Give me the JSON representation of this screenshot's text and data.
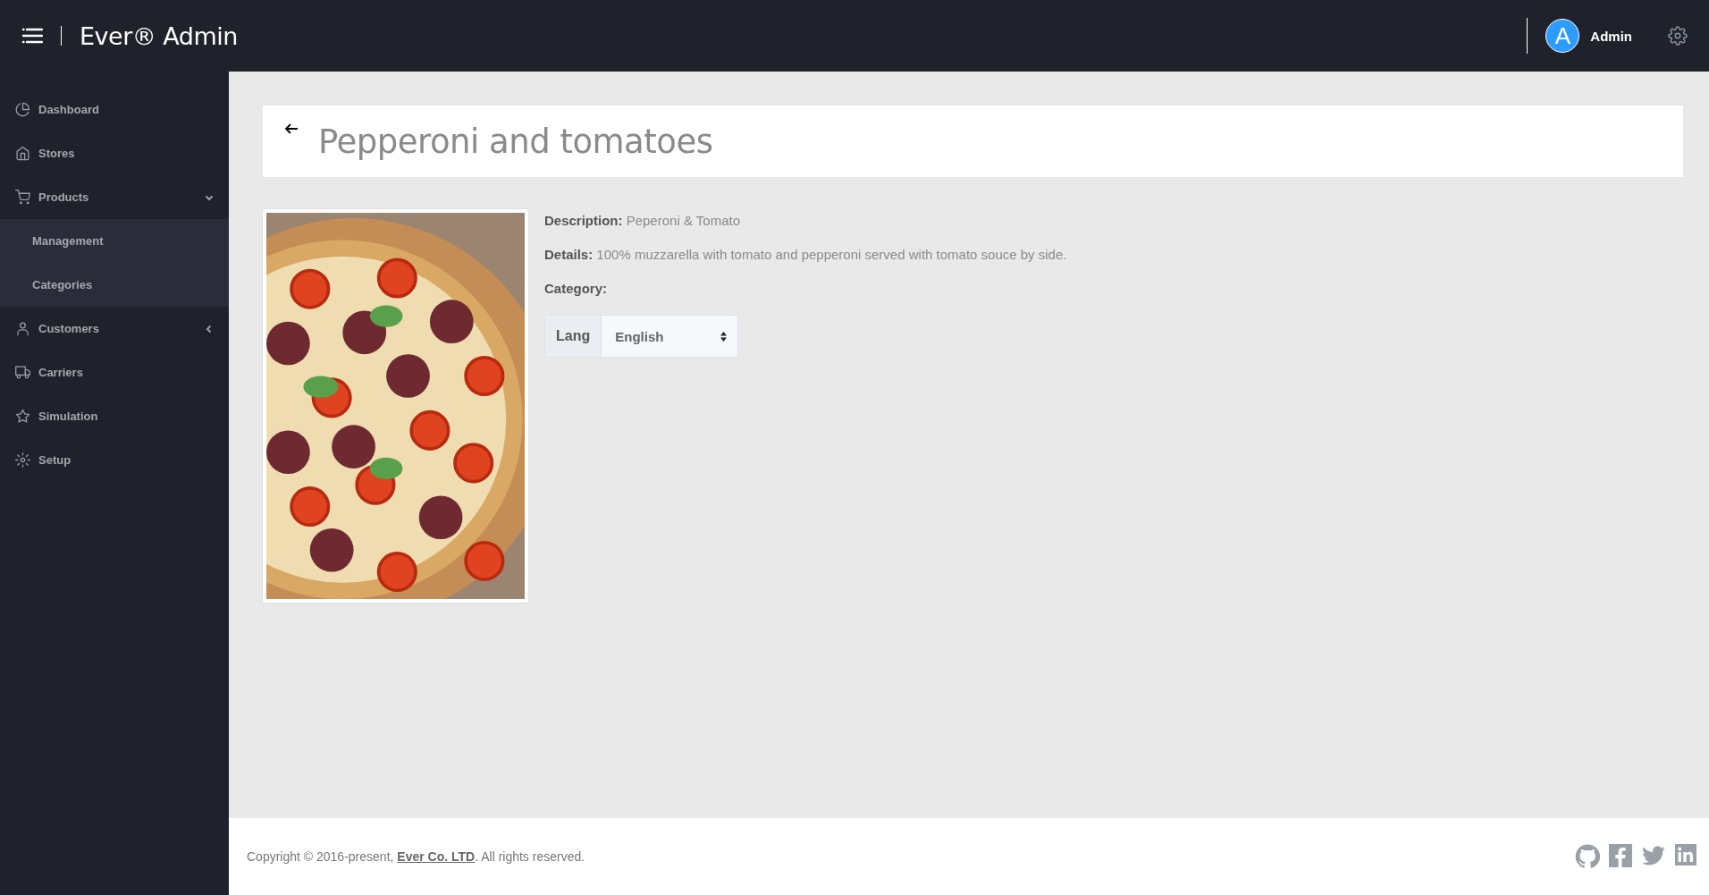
{
  "header": {
    "brand": "Ever® Admin",
    "user": {
      "initial": "A",
      "name": "Admin"
    }
  },
  "sidebar": {
    "items": [
      {
        "label": "Dashboard",
        "selected": false
      },
      {
        "label": "Stores",
        "selected": false
      },
      {
        "label": "Products",
        "selected": false,
        "expanded": true,
        "children": [
          {
            "label": "Management",
            "selected": false
          },
          {
            "label": "Categories",
            "selected": false
          }
        ]
      },
      {
        "label": "Customers",
        "selected": false,
        "expanded": false
      },
      {
        "label": "Carriers",
        "selected": false
      },
      {
        "label": "Simulation",
        "selected": false
      },
      {
        "label": "Setup",
        "selected": false
      }
    ]
  },
  "product": {
    "title": "Pepperoni and tomatoes",
    "fields": [
      {
        "label": "Description:",
        "value": "Peperoni & Tomato"
      },
      {
        "label": "Details:",
        "value": "100% muzzarella with tomato and pepperoni served with tomato souce by side."
      },
      {
        "label": "Category:"
      }
    ],
    "language": {
      "label": "Lang",
      "value": "English"
    }
  },
  "footer": {
    "text_before": "Copyright © 2016-present, ",
    "link": "Ever Co. LTD",
    "text_after": ". All rights reserved."
  }
}
